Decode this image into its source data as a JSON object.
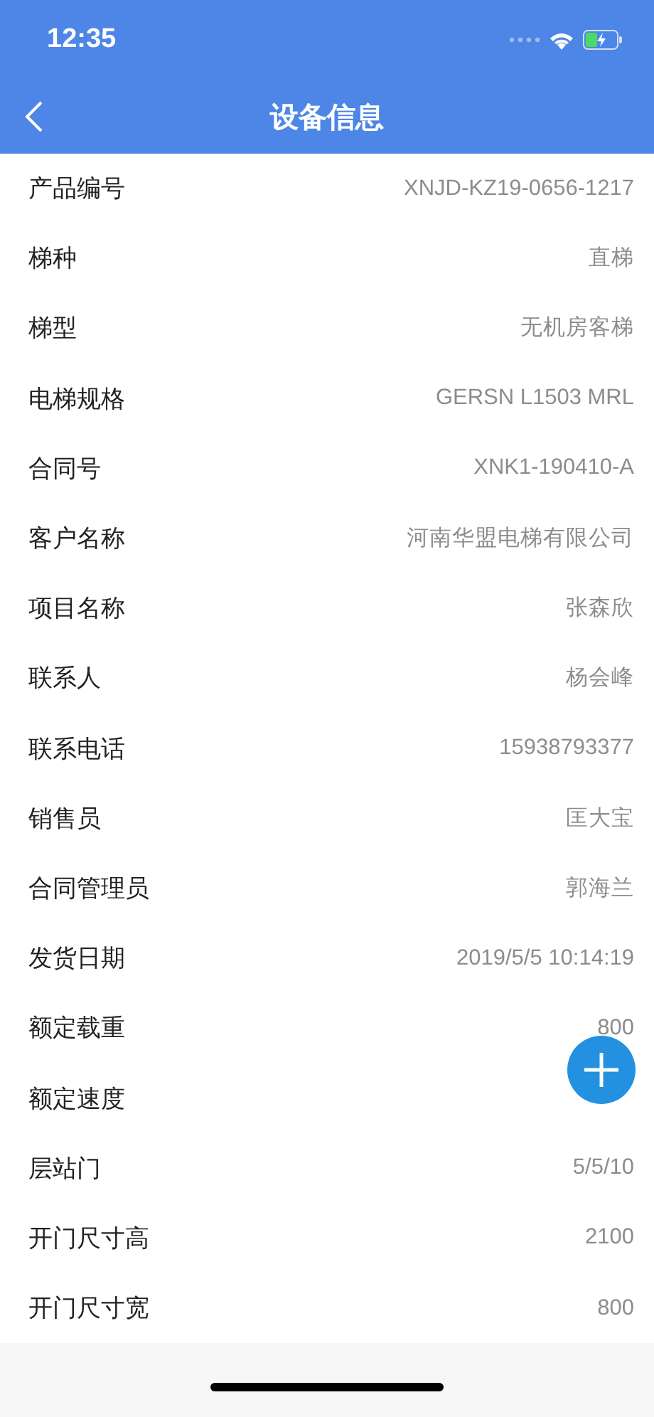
{
  "status_bar": {
    "time": "12:35"
  },
  "nav": {
    "title": "设备信息"
  },
  "fields": [
    {
      "label": "产品编号",
      "value": "XNJD-KZ19-0656-1217"
    },
    {
      "label": "梯种",
      "value": "直梯"
    },
    {
      "label": "梯型",
      "value": "无机房客梯"
    },
    {
      "label": "电梯规格",
      "value": "GERSN L1503 MRL"
    },
    {
      "label": "合同号",
      "value": "XNK1-190410-A"
    },
    {
      "label": "客户名称",
      "value": "河南华盟电梯有限公司"
    },
    {
      "label": "项目名称",
      "value": "张森欣"
    },
    {
      "label": "联系人",
      "value": "杨会峰"
    },
    {
      "label": "联系电话",
      "value": "15938793377"
    },
    {
      "label": "销售员",
      "value": "匡大宝"
    },
    {
      "label": "合同管理员",
      "value": "郭海兰"
    },
    {
      "label": "发货日期",
      "value": "2019/5/5 10:14:19"
    },
    {
      "label": "额定载重",
      "value": "800"
    },
    {
      "label": "额定速度"
    },
    {
      "label": "层站门",
      "value": "5/5/10"
    },
    {
      "label": "开门尺寸高",
      "value": "2100"
    },
    {
      "label": "开门尺寸宽",
      "value": "800"
    }
  ]
}
